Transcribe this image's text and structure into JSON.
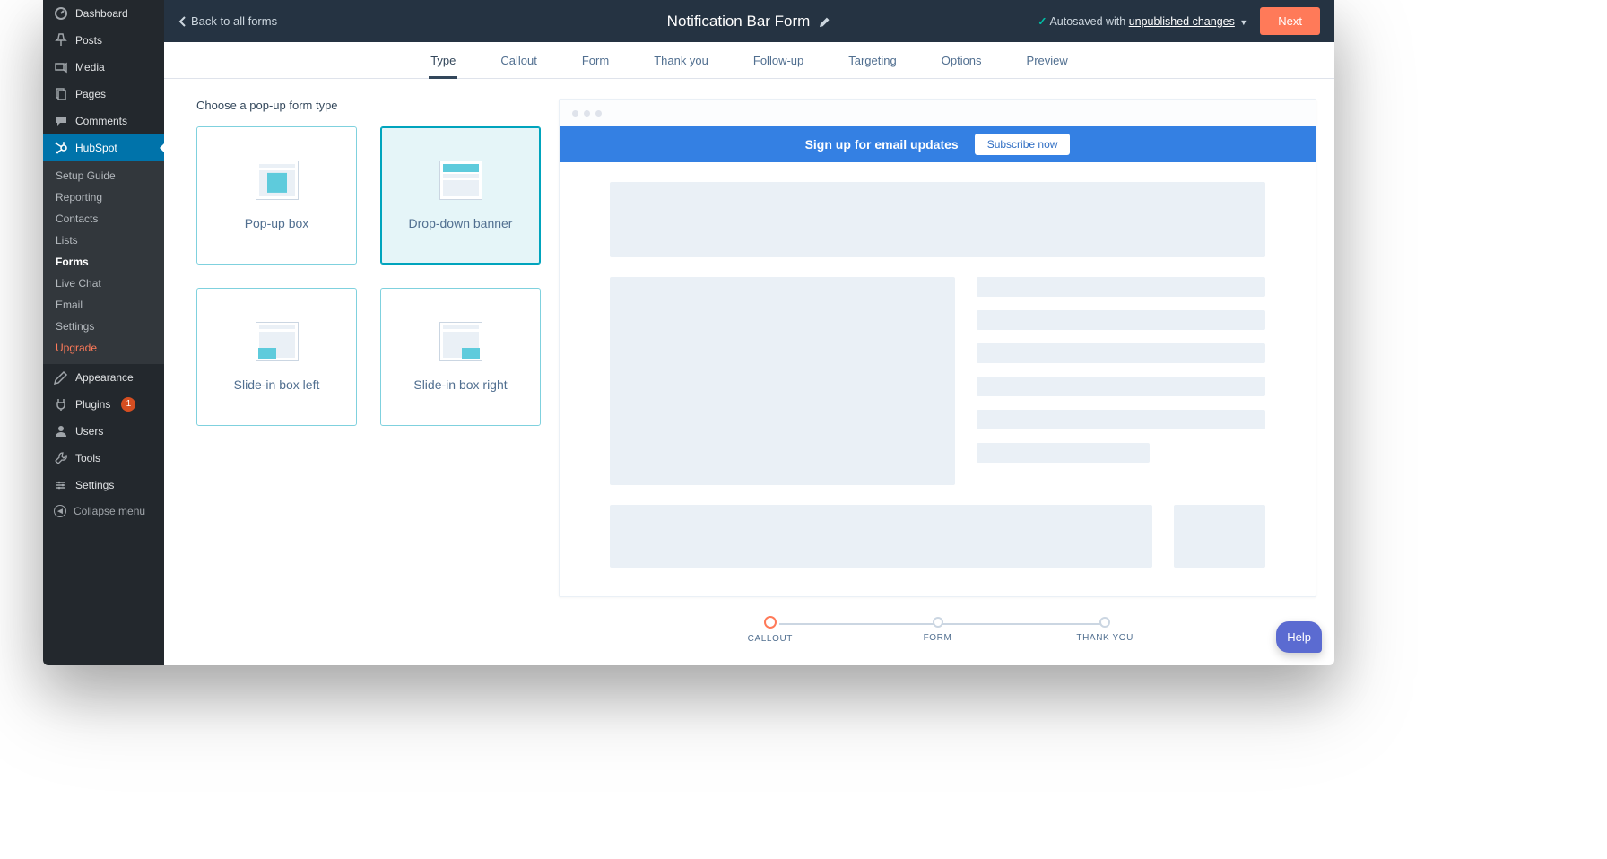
{
  "sidebar": {
    "main": [
      {
        "label": "Dashboard",
        "icon": "dashboard"
      },
      {
        "label": "Posts",
        "icon": "pin"
      },
      {
        "label": "Media",
        "icon": "media"
      },
      {
        "label": "Pages",
        "icon": "pages"
      },
      {
        "label": "Comments",
        "icon": "comments"
      },
      {
        "label": "HubSpot",
        "icon": "hubspot"
      },
      {
        "label": "Appearance",
        "icon": "appearance"
      },
      {
        "label": "Plugins",
        "icon": "plugins",
        "badge": "1"
      },
      {
        "label": "Users",
        "icon": "users"
      },
      {
        "label": "Tools",
        "icon": "tools"
      },
      {
        "label": "Settings",
        "icon": "settings"
      },
      {
        "label": "Collapse menu",
        "icon": "collapse"
      }
    ],
    "sub": [
      {
        "label": "Setup Guide"
      },
      {
        "label": "Reporting"
      },
      {
        "label": "Contacts"
      },
      {
        "label": "Lists"
      },
      {
        "label": "Forms",
        "active": true
      },
      {
        "label": "Live Chat"
      },
      {
        "label": "Email"
      },
      {
        "label": "Settings"
      },
      {
        "label": "Upgrade",
        "orange": true
      }
    ]
  },
  "topbar": {
    "back": "Back to all forms",
    "title": "Notification Bar Form",
    "autosave_prefix": "Autosaved with ",
    "autosave_link": "unpublished changes",
    "next": "Next"
  },
  "tabs": [
    "Type",
    "Callout",
    "Form",
    "Thank you",
    "Follow-up",
    "Targeting",
    "Options",
    "Preview"
  ],
  "active_tab": "Type",
  "left": {
    "heading": "Choose a pop-up form type",
    "cards": [
      "Pop-up box",
      "Drop-down banner",
      "Slide-in box left",
      "Slide-in box right"
    ],
    "selected": 1
  },
  "preview": {
    "banner_text": "Sign up for email updates",
    "banner_button": "Subscribe now"
  },
  "stepper": [
    "CALLOUT",
    "FORM",
    "THANK YOU"
  ],
  "help": "Help"
}
